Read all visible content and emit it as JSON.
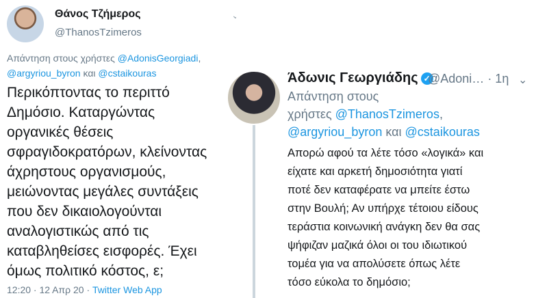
{
  "left_tweet": {
    "name": "Θάνος Τζήμερος",
    "handle": "@ThanosTzimeros",
    "reply_prefix": "Απάντηση στους χρήστες ",
    "reply_user1": "@AdonisGeorgiadi",
    "reply_sep1": ",",
    "reply_user2": "@argyriou_byron",
    "reply_and": " και ",
    "reply_user3": "@cstaikouras",
    "lines": [
      "Περικόπτοντας το περιττό",
      "Δημόσιο. Καταργώντας",
      "οργανικές θέσεις",
      "σφραγιδοκρατόρων, κλείνοντας",
      "άχρηστους οργανισμούς,",
      "μειώνοντας μεγάλες συντάξεις",
      "που δεν δικαιολογούνται",
      "αναλογιστικώς από τις",
      "καταβληθείσες εισφορές. Έχει",
      "όμως πολιτικό κόστος, ε;"
    ],
    "time": "12:20 · 12 Απρ 20 · ",
    "source": "Twitter Web App"
  },
  "right_tweet": {
    "name": "Άδωνις Γεωργιάδης",
    "verified_glyph": "✓",
    "handle": "@Adoni…",
    "age": " · 1η",
    "reply_prefix_line1": "Απάντηση στους",
    "reply_prefix_line2": "χρήστες ",
    "reply_user1": "@ThanosTzimeros",
    "reply_sep1": ",",
    "reply_user2": "@argyriou_byron",
    "reply_and": " και ",
    "reply_user3": "@cstaikouras",
    "lines": [
      "Απορώ αφού τα λέτε τόσο «λογικά» και",
      "είχατε και αρκετή δημοσιότητα γιατί",
      "ποτέ δεν καταφέρατε να μπείτε έστω",
      "στην Βουλή; Αν υπήρχε τέτοιου είδους",
      "τεράστια κοινωνική ανάγκη δεν θα σας",
      "ψήφιζαν μαζικά όλοι οι του ιδιωτικού",
      "τομέα για να απολύσετε όπως λέτε",
      "τόσο εύκολα το δημόσιο;"
    ]
  },
  "icons": {
    "chevron": "chevron-down-icon",
    "verified": "verified-badge-icon"
  },
  "colors": {
    "link": "#1b95e0",
    "muted": "#657786",
    "verified": "#1da1f2"
  }
}
